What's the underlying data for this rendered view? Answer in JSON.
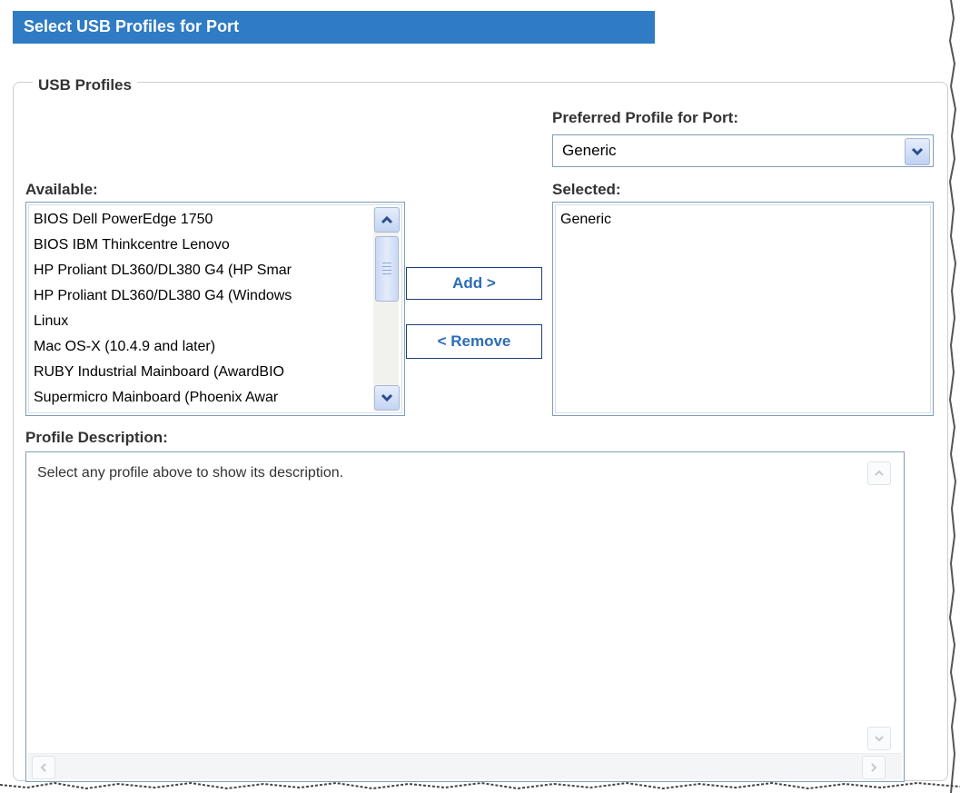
{
  "title": "Select USB Profiles for Port",
  "group_label": "USB Profiles",
  "preferred": {
    "label": "Preferred Profile for Port:",
    "value": "Generic"
  },
  "available": {
    "label": "Available:",
    "items": [
      "BIOS Dell PowerEdge 1750",
      "BIOS IBM Thinkcentre Lenovo",
      "HP Proliant DL360/DL380 G4 (HP Smar",
      "HP Proliant DL360/DL380 G4 (Windows",
      "Linux",
      "Mac OS-X (10.4.9 and later)",
      "RUBY Industrial Mainboard (AwardBIO",
      "Supermicro Mainboard (Phoenix Awar"
    ]
  },
  "selected": {
    "label": "Selected:",
    "items": [
      "Generic"
    ]
  },
  "buttons": {
    "add": "Add >",
    "remove": "< Remove"
  },
  "description": {
    "label": "Profile Description:",
    "text": "Select any profile above to show its description."
  },
  "colors": {
    "title_bar": "#2f7bc4",
    "button_text": "#2c6cb7",
    "border": "#7f9db9"
  },
  "icons": {
    "dropdown": "chevron-down-icon",
    "scroll_up": "chevron-up-icon",
    "scroll_down": "chevron-down-icon",
    "scroll_left": "chevron-left-icon",
    "scroll_right": "chevron-right-icon"
  }
}
